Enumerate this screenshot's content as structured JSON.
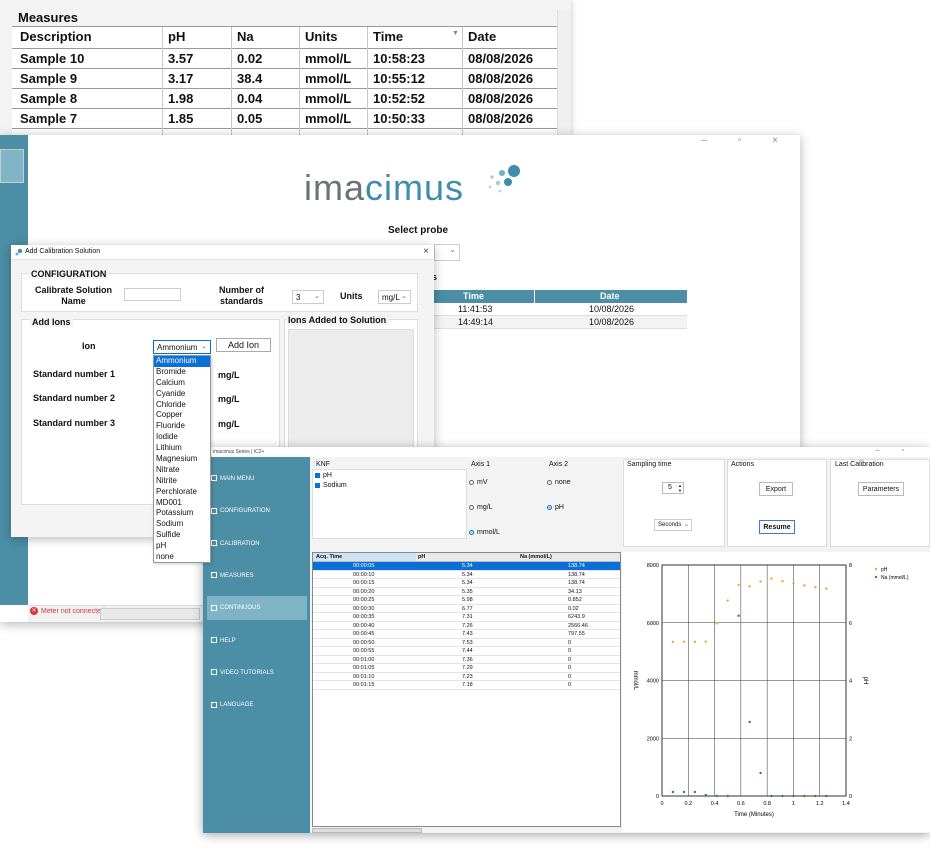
{
  "measures_window": {
    "title": "Measures",
    "columns": [
      "Description",
      "pH",
      "Na",
      "Units",
      "Time",
      "Date"
    ],
    "rows": [
      [
        "Sample 10",
        "3.57",
        "0.02",
        "mmol/L",
        "10:58:23",
        "08/08/2026"
      ],
      [
        "Sample 9",
        "3.17",
        "38.4",
        "mmol/L",
        "10:55:12",
        "08/08/2026"
      ],
      [
        "Sample 8",
        "1.98",
        "0.04",
        "mmol/L",
        "10:52:52",
        "08/08/2026"
      ],
      [
        "Sample 7",
        "1.85",
        "0.05",
        "mmol/L",
        "10:50:33",
        "08/08/2026"
      ]
    ],
    "sort_icon": "sort-down-icon"
  },
  "main_window": {
    "logo": {
      "part1": "ima",
      "part2": "cimus"
    },
    "select_probe_label": "Select probe",
    "table_partial_title": "s",
    "calib_columns": [
      "Time",
      "Date"
    ],
    "calib_rows": [
      [
        "11:41:53",
        "10/08/2026"
      ],
      [
        "14:49:14",
        "10/08/2026"
      ]
    ],
    "status_text": "Meter not connected",
    "window_controls": "–  ▫  ×",
    "accent": "#4b8ea5"
  },
  "cal_dialog": {
    "title": "Add Calibration Solution",
    "close": "×",
    "configuration_title": "CONFIGURATION",
    "calibrate_solution_name_line1": "Calibrate Solution",
    "calibrate_solution_name_line2": "Name",
    "number_of_standards_line1": "Number of",
    "number_of_standards_line2": "standards",
    "num_standards_value": "3",
    "units_label": "Units",
    "units_value": "mg/L",
    "add_ions_title": "Add Ions",
    "ions_added_title": "Ions Added to Solution",
    "ion_label": "Ion",
    "ion_selected": "Ammonium",
    "add_ion_button": "Add Ion",
    "standards": [
      {
        "label": "Standard number 1",
        "unit": "mg/L"
      },
      {
        "label": "Standard number 2",
        "unit": "mg/L"
      },
      {
        "label": "Standard number 3",
        "unit": "mg/L"
      }
    ],
    "ion_options": [
      "Ammonium",
      "Bromide",
      "Calcium",
      "Cyanide",
      "Chloride",
      "Copper",
      "Fluoride",
      "Iodide",
      "Lithium",
      "Magnesium",
      "Nitrate",
      "Nitrite",
      "Perchlorate",
      "MD001",
      "Potassium",
      "Sodium",
      "Sulfide",
      "pH",
      "none"
    ]
  },
  "ic_window": {
    "title": "imacimus Series | IC2+",
    "window_controls": "–  ▫",
    "nav": [
      {
        "label": "MAIN MENU",
        "icon": "grid-icon"
      },
      {
        "label": "CONFIGURATION",
        "icon": "sliders-icon"
      },
      {
        "label": "CALIBRATION",
        "icon": "flask-icon"
      },
      {
        "label": "MEASURES",
        "icon": "list-icon"
      },
      {
        "label": "CONTINUOUS",
        "icon": "chart-icon",
        "active": true
      },
      {
        "label": "HELP",
        "icon": "help-icon"
      },
      {
        "label": "VIDEO TUTORIALS",
        "icon": "video-icon"
      },
      {
        "label": "LANGUAGE",
        "icon": "flag-icon"
      }
    ],
    "knf": {
      "title": "KNF",
      "items": [
        "pH",
        "Sodium"
      ]
    },
    "axis1": {
      "title": "Axis 1",
      "options": [
        "mV",
        "mg/L",
        "mmol/L"
      ],
      "selected": "mmol/L"
    },
    "axis2": {
      "title": "Axis 2",
      "options": [
        "none",
        "pH"
      ],
      "selected": "pH"
    },
    "sampling": {
      "title": "Sampling time",
      "value": "5",
      "unit": "Seconds"
    },
    "actions": {
      "title": "Actions",
      "export": "Export",
      "resume": "Resume"
    },
    "last_calibration": {
      "title": "Last Calibration",
      "parameters": "Parameters"
    },
    "table": {
      "columns": [
        "Acq. Time",
        "pH",
        "Na (mmol/L)"
      ],
      "rows": [
        [
          "00:00:05",
          "5.34",
          "138.74"
        ],
        [
          "00:00:10",
          "5.34",
          "138.74"
        ],
        [
          "00:00:15",
          "5.34",
          "138.74"
        ],
        [
          "00:00:20",
          "5.35",
          "34.13"
        ],
        [
          "00:00:25",
          "5.98",
          "0.852"
        ],
        [
          "00:00:30",
          "6.77",
          "0.02"
        ],
        [
          "00:00:35",
          "7.31",
          "6243.9"
        ],
        [
          "00:00:40",
          "7.26",
          "2566.46"
        ],
        [
          "00:00:45",
          "7.43",
          "797.55"
        ],
        [
          "00:00:50",
          "7.53",
          "0"
        ],
        [
          "00:00:55",
          "7.44",
          "0"
        ],
        [
          "00:01:00",
          "7.36",
          "0"
        ],
        [
          "00:01:05",
          "7.29",
          "0"
        ],
        [
          "00:01:10",
          "7.23",
          "0"
        ],
        [
          "00:01:15",
          "7.18",
          "0"
        ]
      ]
    }
  },
  "chart_data": {
    "type": "scatter",
    "xlabel": "Time (Minutes)",
    "ylabel": "mmol/L",
    "y2label": "pH",
    "xlim": [
      0,
      1.4
    ],
    "ylim": [
      0,
      8000
    ],
    "y2lim": [
      0,
      8
    ],
    "xticks": [
      "0",
      "0.2",
      "0.4",
      "0.6",
      "0.8",
      "1",
      "1.2",
      "1.4"
    ],
    "yticks": [
      "0",
      "2000",
      "4000",
      "6000",
      "8000"
    ],
    "y2ticks": [
      "0",
      "2",
      "4",
      "6",
      "8"
    ],
    "legend_position": "top-right",
    "series": [
      {
        "name": "pH",
        "axis": "right",
        "color": "#f5a623",
        "x": [
          0.083,
          0.167,
          0.25,
          0.333,
          0.417,
          0.5,
          0.583,
          0.667,
          0.75,
          0.833,
          0.917,
          1.0,
          1.083,
          1.167,
          1.25
        ],
        "y": [
          5.34,
          5.34,
          5.34,
          5.35,
          5.98,
          6.77,
          7.31,
          7.26,
          7.43,
          7.53,
          7.44,
          7.36,
          7.29,
          7.23,
          7.18
        ]
      },
      {
        "name": "Na (mmol/L)",
        "axis": "left",
        "color": "#2a8a2a",
        "x": [
          0.083,
          0.167,
          0.25,
          0.333,
          0.417,
          0.5,
          0.583,
          0.667,
          0.75,
          0.833,
          0.917,
          1.0,
          1.083,
          1.167,
          1.25
        ],
        "y": [
          138.74,
          138.74,
          138.74,
          34.13,
          0.852,
          0.02,
          6243.9,
          2566.46,
          797.55,
          0,
          0,
          0,
          0,
          0,
          0
        ]
      }
    ]
  }
}
